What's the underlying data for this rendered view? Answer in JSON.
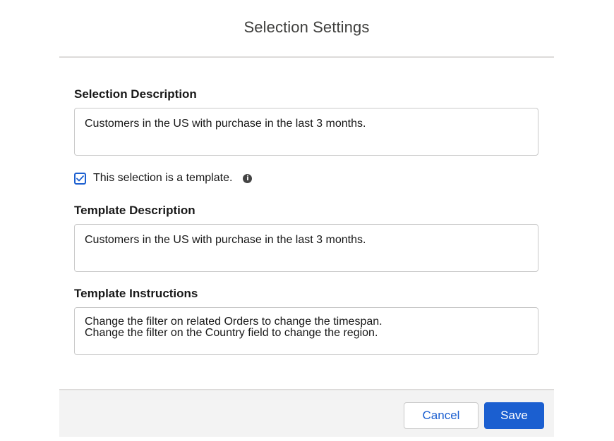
{
  "modal": {
    "title": "Selection Settings"
  },
  "form": {
    "selection_description": {
      "label": "Selection Description",
      "value": "Customers in the US with purchase in the last 3 months."
    },
    "template_checkbox": {
      "label": "This selection is a template.",
      "checked": true,
      "info_icon": "info-icon"
    },
    "template_description": {
      "label": "Template Description",
      "value": "Customers in the US with purchase in the last 3 months."
    },
    "template_instructions": {
      "label": "Template Instructions",
      "value": "Change the filter on related Orders to change the timespan.\nChange the filter on the Country field to change the region."
    }
  },
  "footer": {
    "cancel_label": "Cancel",
    "save_label": "Save"
  },
  "colors": {
    "brand": "#1b5fd0",
    "footer_bg": "#f3f3f3",
    "border": "#c9c9c9"
  }
}
